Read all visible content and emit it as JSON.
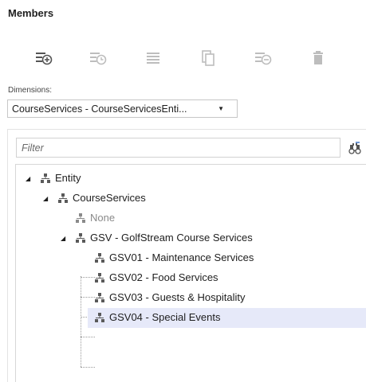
{
  "panel": {
    "title": "Members"
  },
  "toolbar": {
    "buttons": [
      {
        "name": "add-member",
        "icon": "list-add-icon",
        "enabled": true
      },
      {
        "name": "member-history",
        "icon": "list-clock-icon",
        "enabled": false
      },
      {
        "name": "member-properties",
        "icon": "list-lines-icon",
        "enabled": false
      },
      {
        "name": "copy-member",
        "icon": "copy-icon",
        "enabled": false
      },
      {
        "name": "remove-member",
        "icon": "list-remove-icon",
        "enabled": false
      },
      {
        "name": "delete-member",
        "icon": "trash-icon",
        "enabled": false
      }
    ]
  },
  "dimensions": {
    "label": "Dimensions:",
    "selected": "CourseServices - CourseServicesEnti..."
  },
  "filter": {
    "placeholder": "Filter",
    "value": ""
  },
  "tree": {
    "nodes": [
      {
        "label": "Entity",
        "level": 0,
        "expanded": true
      },
      {
        "label": "CourseServices",
        "level": 1,
        "expanded": true
      },
      {
        "label": "None",
        "level": 2,
        "leaf": true,
        "dimmed": true
      },
      {
        "label": "GSV - GolfStream Course Services",
        "level": 2,
        "expanded": true
      },
      {
        "label": "GSV01 - Maintenance Services",
        "level": 3,
        "leaf": true
      },
      {
        "label": "GSV02 - Food Services",
        "level": 3,
        "leaf": true
      },
      {
        "label": "GSV03 - Guests & Hospitality",
        "level": 3,
        "leaf": true
      },
      {
        "label": "GSV04 - Special Events",
        "level": 3,
        "leaf": true,
        "selected": true
      }
    ]
  },
  "colors": {
    "selection": "#e6e9f9",
    "icon_dark": "#5a5a5a",
    "icon_disabled": "#bdbdbd"
  }
}
